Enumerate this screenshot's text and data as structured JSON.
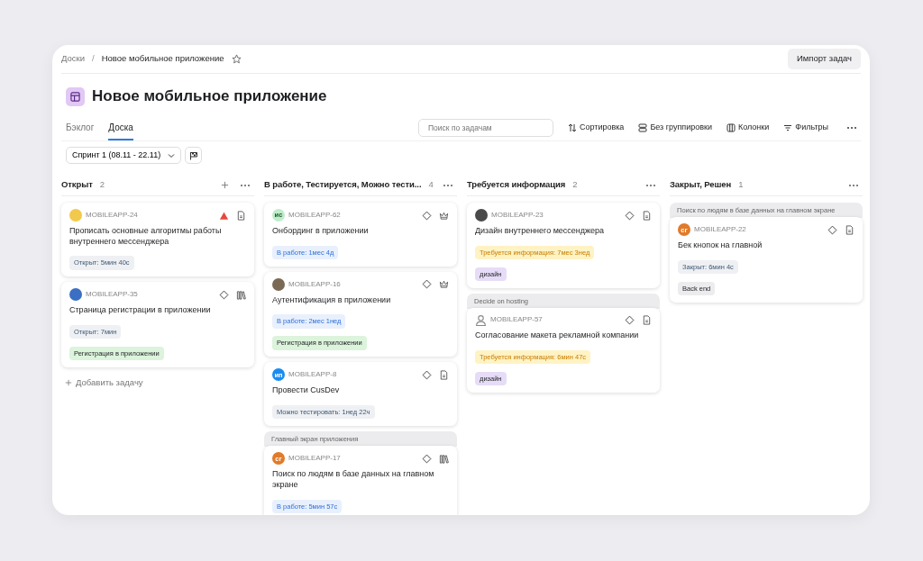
{
  "breadcrumbs": {
    "root": "Доски",
    "separator": "/",
    "current": "Новое мобильное приложение",
    "favorite": false
  },
  "import_button": "Импорт задач",
  "title": "Новое мобильное приложение",
  "tabs": [
    {
      "label": "Бэклог",
      "selected": false
    },
    {
      "label": "Доска",
      "selected": true
    }
  ],
  "search": {
    "placeholder": "Поиск по задачам"
  },
  "toolbar": [
    {
      "kind": "sort",
      "label": "Сортировка"
    },
    {
      "kind": "group",
      "label": "Без группировки"
    },
    {
      "kind": "columns",
      "label": "Колонки"
    },
    {
      "kind": "filter",
      "label": "Фильтры"
    }
  ],
  "sprint": "Спринт 1 (08.11 - 22.11)",
  "columns": [
    {
      "title": "Открыт",
      "count": "2",
      "add_task": "Добавить задачу",
      "cards": [
        {
          "avatar": {
            "kind": "photo",
            "color": "#f2c94c"
          },
          "key": "MOBILEAPP-24",
          "icons": [
            {
              "kind": "critical"
            },
            {
              "kind": "document"
            }
          ],
          "title": "Прописать основные алгоритмы работы внутреннего мессенджера",
          "status": {
            "kind": "open",
            "text": "Открыт: 5мин 40с"
          }
        },
        {
          "avatar": {
            "kind": "photo",
            "color": "#3a6fc4"
          },
          "key": "MOBILEAPP-35",
          "icons": [
            {
              "kind": "normal"
            },
            {
              "kind": "library"
            }
          ],
          "title": "Страница регистрации в приложении",
          "status": {
            "kind": "open",
            "text": "Открыт: 7мин"
          },
          "tags": [
            {
              "text": "Регистрация в приложении",
              "color": "#dcf3dc"
            }
          ]
        }
      ]
    },
    {
      "title": "В работе, Тестируется, Можно тести...",
      "count": "4",
      "cards": [
        {
          "avatar": {
            "kind": "initials",
            "initials": "ис",
            "color": "#bfeccb"
          },
          "key": "MOBILEAPP-62",
          "icons": [
            {
              "kind": "normal"
            },
            {
              "kind": "crown"
            }
          ],
          "title": "Онбординг в приложении",
          "status": {
            "kind": "progress",
            "text": "В работе: 1мес 4д"
          }
        },
        {
          "avatar": {
            "kind": "photo",
            "color": "#7a6a55"
          },
          "key": "MOBILEAPP-16",
          "icons": [
            {
              "kind": "normal"
            },
            {
              "kind": "crown"
            }
          ],
          "title": "Аутентификация в приложении",
          "status": {
            "kind": "progress",
            "text": "В работе: 2мес 1нед"
          },
          "tags": [
            {
              "text": "Регистрация в приложении",
              "color": "#dcf3dc"
            }
          ]
        },
        {
          "avatar": {
            "kind": "initials",
            "initials": "ип",
            "color": "#1a8cf0"
          },
          "key": "MOBILEAPP-8",
          "icons": [
            {
              "kind": "normal"
            },
            {
              "kind": "document"
            }
          ],
          "title": "Провести CusDev",
          "status": {
            "kind": "open",
            "text": "Можно тестировать: 1нед 22ч"
          }
        },
        {
          "parent": "Главный экран приложения",
          "avatar": {
            "kind": "initials",
            "initials": "сг",
            "color": "#e07b2a"
          },
          "key": "MOBILEAPP-17",
          "icons": [
            {
              "kind": "normal"
            },
            {
              "kind": "library"
            }
          ],
          "title": "Поиск по людям в базе данных на главном экране",
          "status": {
            "kind": "progress",
            "text": "В работе: 5мин 57с"
          }
        }
      ]
    },
    {
      "title": "Требуется информация",
      "count": "2",
      "cards": [
        {
          "avatar": {
            "kind": "photo",
            "color": "#4a4a4a"
          },
          "key": "MOBILEAPP-23",
          "icons": [
            {
              "kind": "normal"
            },
            {
              "kind": "document"
            }
          ],
          "title": "Дизайн внутреннего мессенджера",
          "status": {
            "kind": "info",
            "text": "Требуется информация: 7мес 3нед"
          },
          "tags": [
            {
              "text": "дизайн",
              "color": "#e6dcf7"
            }
          ]
        },
        {
          "parent": "Decide on hosting",
          "avatar": {
            "kind": "person"
          },
          "key": "MOBILEAPP-57",
          "icons": [
            {
              "kind": "normal"
            },
            {
              "kind": "document"
            }
          ],
          "title": "Согласование макета рекламной компании",
          "status": {
            "kind": "info",
            "text": "Требуется информация: 6мин 47с"
          },
          "tags": [
            {
              "text": "дизайн",
              "color": "#e6dcf7"
            }
          ]
        }
      ]
    },
    {
      "title": "Закрыт, Решен",
      "count": "1",
      "cards": [
        {
          "parent": "Поиск по людям в базе данных на главном экране",
          "avatar": {
            "kind": "initials",
            "initials": "сг",
            "color": "#e07b2a"
          },
          "key": "MOBILEAPP-22",
          "icons": [
            {
              "kind": "normal"
            },
            {
              "kind": "document"
            }
          ],
          "title": "Бек кнопок на главной",
          "status": {
            "kind": "open",
            "text": "Закрыт: 6мин 4с"
          },
          "tags": [
            {
              "text": "Back end",
              "color": "#ececee"
            }
          ]
        }
      ]
    }
  ]
}
